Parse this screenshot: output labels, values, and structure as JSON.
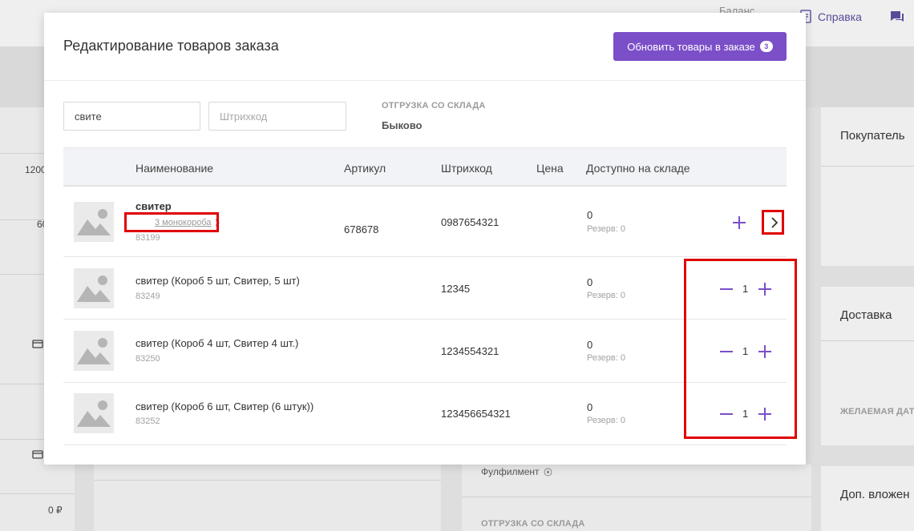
{
  "background": {
    "balance_label": "Баланс",
    "help_label": "Справка",
    "left_values": [
      "1200",
      "60",
      "0 ₽"
    ],
    "right_cards": [
      "Покупатель",
      "Доставка",
      "Доп. вложен"
    ],
    "desired_date_caption": "ЖЕЛАЕМАЯ ДАТА",
    "fulfillment_label": "Фулфилмент",
    "shipment_caption": "ОТГРУЗКА СО СКЛАДА"
  },
  "modal": {
    "title": "Редактирование товаров заказа",
    "update_button_label": "Обновить товары в заказе",
    "update_count": "3",
    "search_value": "свите",
    "barcode_placeholder": "Штрихкод",
    "warehouse_caption": "ОТГРУЗКА СО СКЛАДА",
    "warehouse_name": "Быково",
    "columns": {
      "name": "Наименование",
      "article": "Артикул",
      "barcode": "Штрихкод",
      "price": "Цена",
      "stock": "Доступно на складе"
    },
    "parent": {
      "name": "свитер",
      "packs_link": "3 монокороба",
      "id": "83199",
      "article": "678678",
      "barcode": "0987654321",
      "stock": "0",
      "reserve": "Резерв: 0"
    },
    "variants": [
      {
        "name": "свитер (Короб 5 шт, Свитер, 5 шт)",
        "id": "83249",
        "barcode": "12345",
        "stock": "0",
        "reserve": "Резерв: 0",
        "qty": "1"
      },
      {
        "name": "свитер (Короб 4 шт, Свитер 4 шт.)",
        "id": "83250",
        "barcode": "1234554321",
        "stock": "0",
        "reserve": "Резерв: 0",
        "qty": "1"
      },
      {
        "name": "свитер (Короб 6 шт, Свитер (6 штук))",
        "id": "83252",
        "barcode": "123456654321",
        "stock": "0",
        "reserve": "Резерв: 0",
        "qty": "1"
      }
    ]
  },
  "colors": {
    "accent": "#7b4fc8",
    "highlight": "#e00000"
  }
}
